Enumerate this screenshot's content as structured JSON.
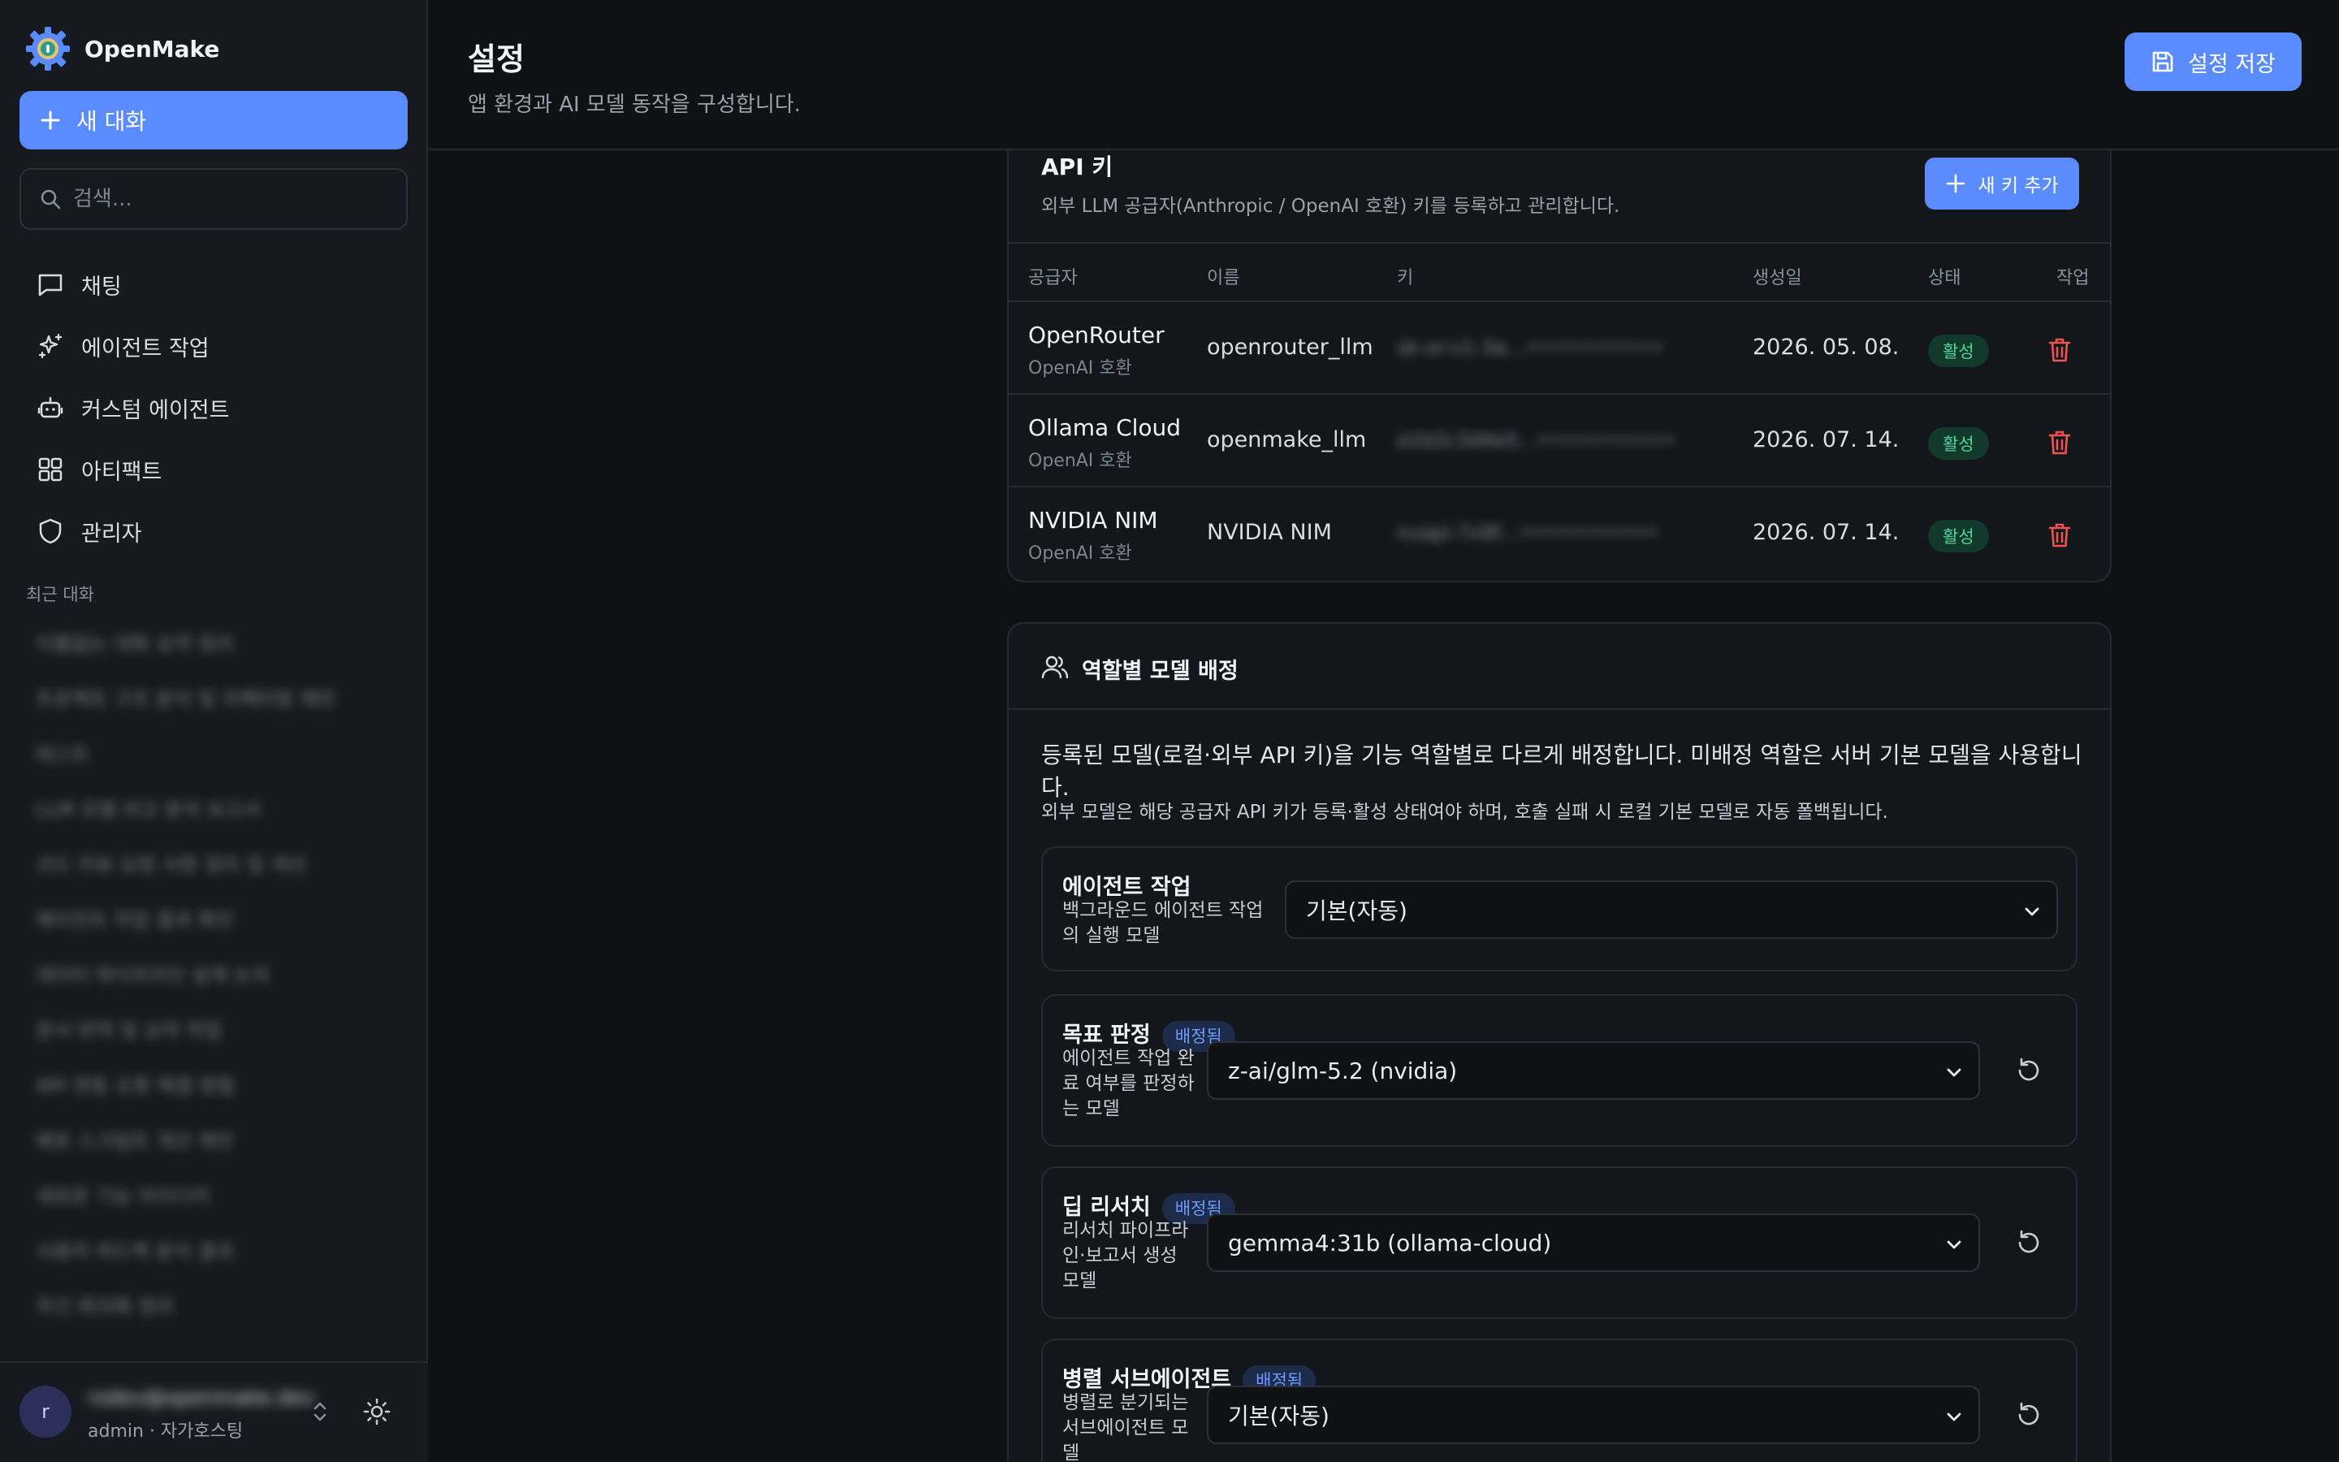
{
  "app": {
    "name": "OpenMake",
    "new_chat_label": "새 대화",
    "search_placeholder": "검색..."
  },
  "nav": [
    {
      "label": "채팅",
      "icon": "chat-bubble-icon"
    },
    {
      "label": "에이전트 작업",
      "icon": "sparkles-icon"
    },
    {
      "label": "커스텀 에이전트",
      "icon": "robot-icon"
    },
    {
      "label": "아티팩트",
      "icon": "grid-icon"
    },
    {
      "label": "관리자",
      "icon": "shield-icon"
    }
  ],
  "recent": {
    "title": "최근 대화",
    "items": [
      "이름없는 대화 요약 정리",
      "프로젝트 구조 분석 및 리팩터링 제안",
      "테스트",
      "LLM 모델 비교 분석 보고서",
      "코드 리뷰 요청 사항 정리 및 개선",
      "에이전트 작업 결과 확인",
      "데이터 파이프라인 설계 논의",
      "문서 번역 및 요약 작업",
      "API 연동 오류 해결 방법",
      "배포 스크립트 개선 제안",
      "새로운 기능 아이디어",
      "사용자 피드백 분석 결과",
      "주간 회의록 정리"
    ]
  },
  "user": {
    "initial": "r",
    "email": "rsdev@openmake.dev",
    "role": "admin · 자가호스팅"
  },
  "header": {
    "title": "설정",
    "subtitle": "앱 환경과 AI 모델 동작을 구성합니다.",
    "save_label": "설정 저장"
  },
  "api_keys": {
    "title": "API 키",
    "description": "외부 LLM 공급자(Anthropic / OpenAI 호환) 키를 등록하고 관리합니다.",
    "add_label": "새 키 추가",
    "columns": {
      "provider": "공급자",
      "name": "이름",
      "key": "키",
      "created": "생성일",
      "status": "상태",
      "action": "작업"
    },
    "rows": [
      {
        "provider": "OpenRouter",
        "provider_type": "OpenAI 호환",
        "name": "openrouter_llm",
        "key": "sk-or-v1-3a…••••••••••••",
        "created": "2026. 05. 08.",
        "status": "활성"
      },
      {
        "provider": "Ollama Cloud",
        "provider_type": "OpenAI 호환",
        "name": "openmake_llm",
        "key": "a1b2c3d4e5…••••••••••••",
        "created": "2026. 07. 14.",
        "status": "활성"
      },
      {
        "provider": "NVIDIA NIM",
        "provider_type": "OpenAI 호환",
        "name": "NVIDIA NIM",
        "key": "nvapi-7x9f…••••••••••••",
        "created": "2026. 07. 14.",
        "status": "활성"
      }
    ]
  },
  "roles": {
    "title": "역할별 모델 배정",
    "description": "등록된 모델(로컬·외부 API 키)을 기능 역할별로 다르게 배정합니다. 미배정 역할은 서버 기본 모델을 사용합니다.",
    "note": "외부 모델은 해당 공급자 API 키가 등록·활성 상태여야 하며, 호출 실패 시 로컬 기본 모델로 자동 폴백됩니다.",
    "items": [
      {
        "label": "에이전트 작업",
        "badge": "",
        "desc": "백그라운드 에이전트 작업의 실행 모델",
        "value": "기본(자동)"
      },
      {
        "label": "목표 판정",
        "badge": "배정됨",
        "desc": "에이전트 작업 완료 여부를 판정하는 모델",
        "value": "z-ai/glm-5.2 (nvidia)"
      },
      {
        "label": "딥 리서치",
        "badge": "배정됨",
        "desc": "리서치 파이프라인·보고서 생성 모델",
        "value": "gemma4:31b (ollama-cloud)"
      },
      {
        "label": "병렬 서브에이전트",
        "badge": "배정됨",
        "desc": "병렬로 분기되는 서브에이전트 모델",
        "value": "기본(자동)"
      }
    ]
  },
  "colors": {
    "accent": "#5b8cff",
    "background": "#0f1115",
    "sidebar": "#16191f",
    "status_active": "#4fd39a",
    "danger": "#ef5350"
  }
}
